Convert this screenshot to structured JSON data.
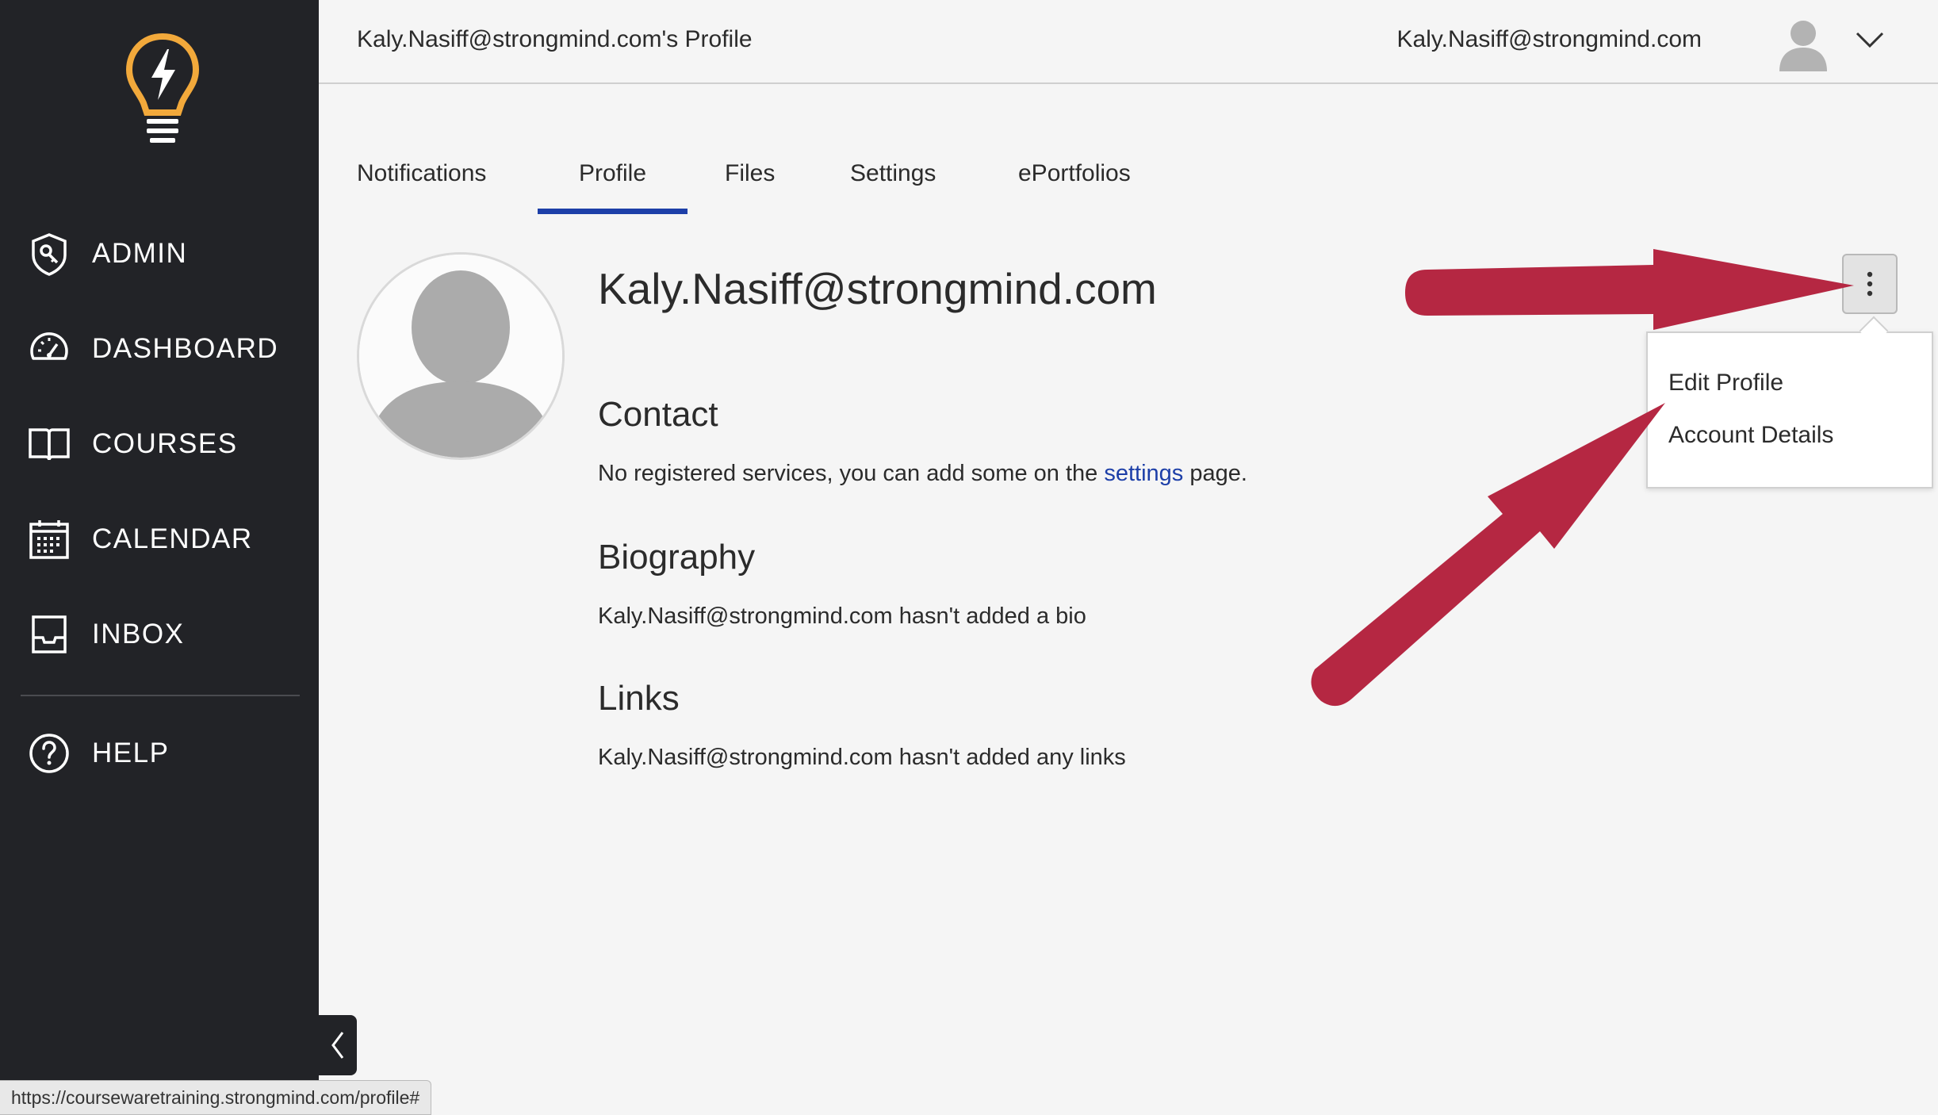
{
  "topbar": {
    "page_title": "Kaly.Nasiff@strongmind.com's Profile",
    "user_email": "Kaly.Nasiff@strongmind.com"
  },
  "sidebar": {
    "logo": "lightbulb-logo",
    "items": [
      {
        "label": "ADMIN",
        "icon": "shield-key-icon"
      },
      {
        "label": "DASHBOARD",
        "icon": "speedometer-icon"
      },
      {
        "label": "COURSES",
        "icon": "open-book-icon"
      },
      {
        "label": "CALENDAR",
        "icon": "calendar-icon"
      },
      {
        "label": "INBOX",
        "icon": "inbox-tray-icon"
      },
      {
        "label": "HELP",
        "icon": "help-circle-icon"
      }
    ]
  },
  "tabs": [
    {
      "label": "Notifications"
    },
    {
      "label": "Profile",
      "active": true
    },
    {
      "label": "Files"
    },
    {
      "label": "Settings"
    },
    {
      "label": "ePortfolios"
    }
  ],
  "profile": {
    "name": "Kaly.Nasiff@strongmind.com",
    "contact": {
      "heading": "Contact",
      "text_before": "No registered services, you can add some on the ",
      "link_text": "settings",
      "text_after": " page."
    },
    "biography": {
      "heading": "Biography",
      "text": "Kaly.Nasiff@strongmind.com hasn't added a bio"
    },
    "links": {
      "heading": "Links",
      "text": "Kaly.Nasiff@strongmind.com hasn't added any links"
    }
  },
  "menu": {
    "items": [
      "Edit Profile",
      "Account Details"
    ]
  },
  "status_url": "https://coursewaretraining.strongmind.com/profile#",
  "colors": {
    "sidebar_bg": "#222327",
    "logo_accent": "#f2a93b",
    "active_tab": "#1d3fa8",
    "link": "#1d3fa8",
    "annotation_arrow": "#b52742"
  }
}
